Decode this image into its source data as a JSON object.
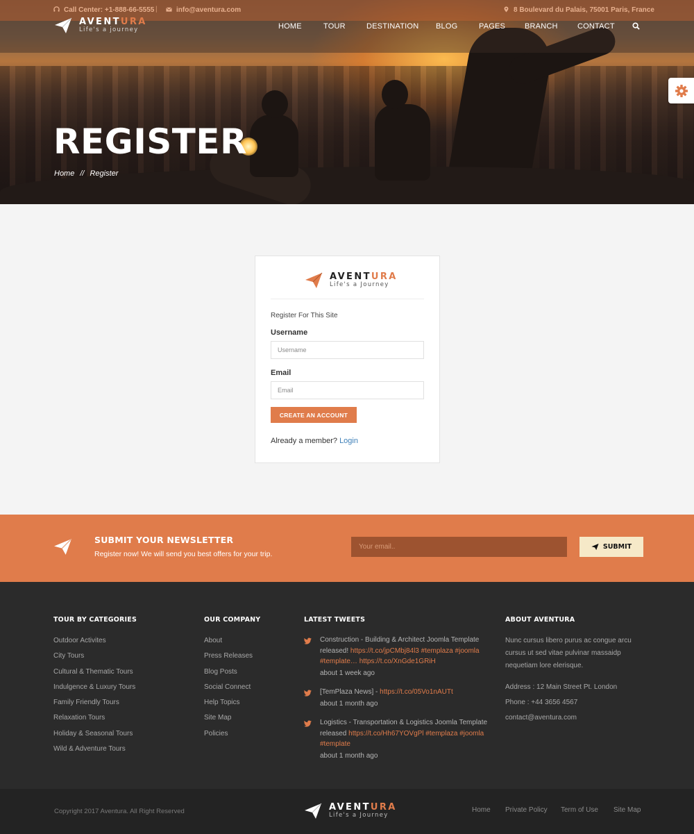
{
  "topbar": {
    "call_center": "Call Center: +1-888-66-5555",
    "separator": "|",
    "email": "info@aventura.com",
    "address": "8 Boulevard du Palais, 75001 Paris, France"
  },
  "brand": {
    "name_part1": "AVENT",
    "name_part2": "URA",
    "tagline_header": "Life's a journey",
    "tagline": "Life's a Journey"
  },
  "nav": {
    "items": [
      "HOME",
      "TOUR",
      "DESTINATION",
      "BLOG",
      "PAGES",
      "BRANCH",
      "CONTACT"
    ]
  },
  "hero": {
    "title": "REGISTER",
    "breadcrumb": {
      "home": "Home",
      "separator": "//",
      "current": "Register"
    }
  },
  "register": {
    "subtitle": "Register For This Site",
    "username_label": "Username",
    "username_placeholder": "Username",
    "email_label": "Email",
    "email_placeholder": "Email",
    "submit_label": "CREATE AN ACCOUNT",
    "already_text": "Already a member?",
    "login_link": "Login"
  },
  "newsletter": {
    "title": "SUBMIT YOUR NEWSLETTER",
    "text": "Register now! We will send you best offers for your trip.",
    "placeholder": "Your email..",
    "button": "SUBMIT"
  },
  "footer": {
    "categories": {
      "title": "TOUR BY CATEGORIES",
      "items": [
        "Outdoor Activites",
        "City Tours",
        "Cultural & Thematic Tours",
        "Indulgence & Luxury Tours",
        "Family Friendly Tours",
        "Relaxation Tours",
        "Holiday & Seasonal Tours",
        "Wild & Adventure Tours"
      ]
    },
    "company": {
      "title": "OUR COMPANY",
      "items": [
        "About",
        "Press Releases",
        "Blog Posts",
        "Social Connect",
        "Help Topics",
        "Site Map",
        "Policies"
      ]
    },
    "tweets": {
      "title": "LATEST TWEETS",
      "items": [
        {
          "text": "Construction - Building & Architect Joomla Template released!",
          "links": "https://t.co/jpCMbj84l3 #templaza #joomla #template… https://t.co/XnGde1GRiH",
          "time": "about 1 week ago"
        },
        {
          "text": "[TemPlaza News] -",
          "links": "https://t.co/05Vo1nAUTt",
          "time": "about 1 month ago"
        },
        {
          "text": "Logistics - Transportation & Logistics Joomla Template released",
          "links": "https://t.co/Hh67YOVgPl #templaza #joomla #template",
          "time": "about 1 month ago"
        }
      ]
    },
    "about": {
      "title": "ABOUT AVENTURA",
      "text": "Nunc cursus libero purus ac congue arcu cursus ut sed vitae pulvinar massaidp nequetiam lore elerisque.",
      "address": "Address : 12 Main Street Pt. London",
      "phone": "Phone : +44 3656 4567",
      "email": "contact@aventura.com"
    },
    "copyright": "Copyright 2017 Aventura. All Right Reserved",
    "bottom_links": [
      "Home",
      "Private Policy",
      "Term of Use",
      "Site Map"
    ]
  },
  "colors": {
    "accent": "#e07c4b",
    "footer_bg": "#2b2b2b",
    "link": "#3d7fb8"
  },
  "icons": {
    "logo": "paper-plane-icon",
    "search": "search-icon",
    "settings": "gear-icon",
    "tweet": "twitter-icon"
  }
}
